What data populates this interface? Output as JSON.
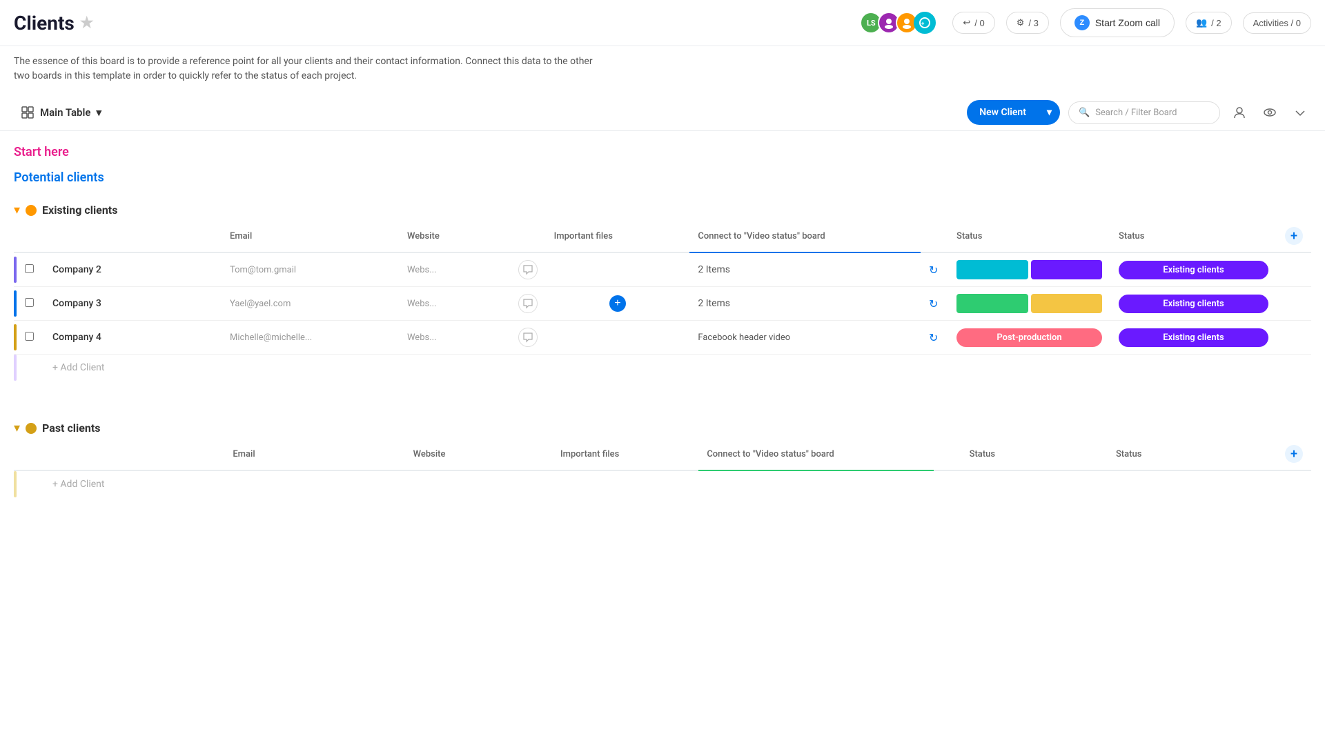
{
  "header": {
    "title": "Clients",
    "description": "The essence of this board is to provide a reference point for all your clients and their contact information. Connect this data to the other two boards in this template in order to quickly refer to the status of each project.",
    "reactions_count": "/ 0",
    "connections_count": "/ 3",
    "zoom_label": "Start Zoom call",
    "members_count": "/ 2",
    "activities_label": "Activities / 0"
  },
  "toolbar": {
    "table_label": "Main Table",
    "new_client_label": "New Client",
    "search_placeholder": "Search / Filter Board"
  },
  "groups": {
    "start_here": "Start here",
    "potential_clients": "Potential clients",
    "existing_clients": "Existing clients",
    "past_clients": "Past clients"
  },
  "columns": {
    "email": "Email",
    "website": "Website",
    "important_files": "Important files",
    "connect_board": "Connect to \"Video status\" board",
    "status": "Status",
    "status2": "Status"
  },
  "existing_rows": [
    {
      "company": "Company 2",
      "email": "Tom@tom.gmail",
      "website": "Webs...",
      "items": "2 Items",
      "status_label": "Existing clients"
    },
    {
      "company": "Company 3",
      "email": "Yael@yael.com",
      "website": "Webs...",
      "items": "2 Items",
      "status_label": "Existing clients"
    },
    {
      "company": "Company 4",
      "email": "Michelle@michelle...",
      "website": "Webs...",
      "items": "Facebook header video",
      "status_label": "Existing clients",
      "status_badge": "Post-production"
    }
  ],
  "add_client_label": "+ Add Client",
  "icons": {
    "star": "★",
    "chevron_down": "▾",
    "chat": "💬",
    "plus": "+",
    "search": "🔍",
    "sync": "↻",
    "person": "👤",
    "eye": "👁",
    "zoom_logo": "Z"
  }
}
